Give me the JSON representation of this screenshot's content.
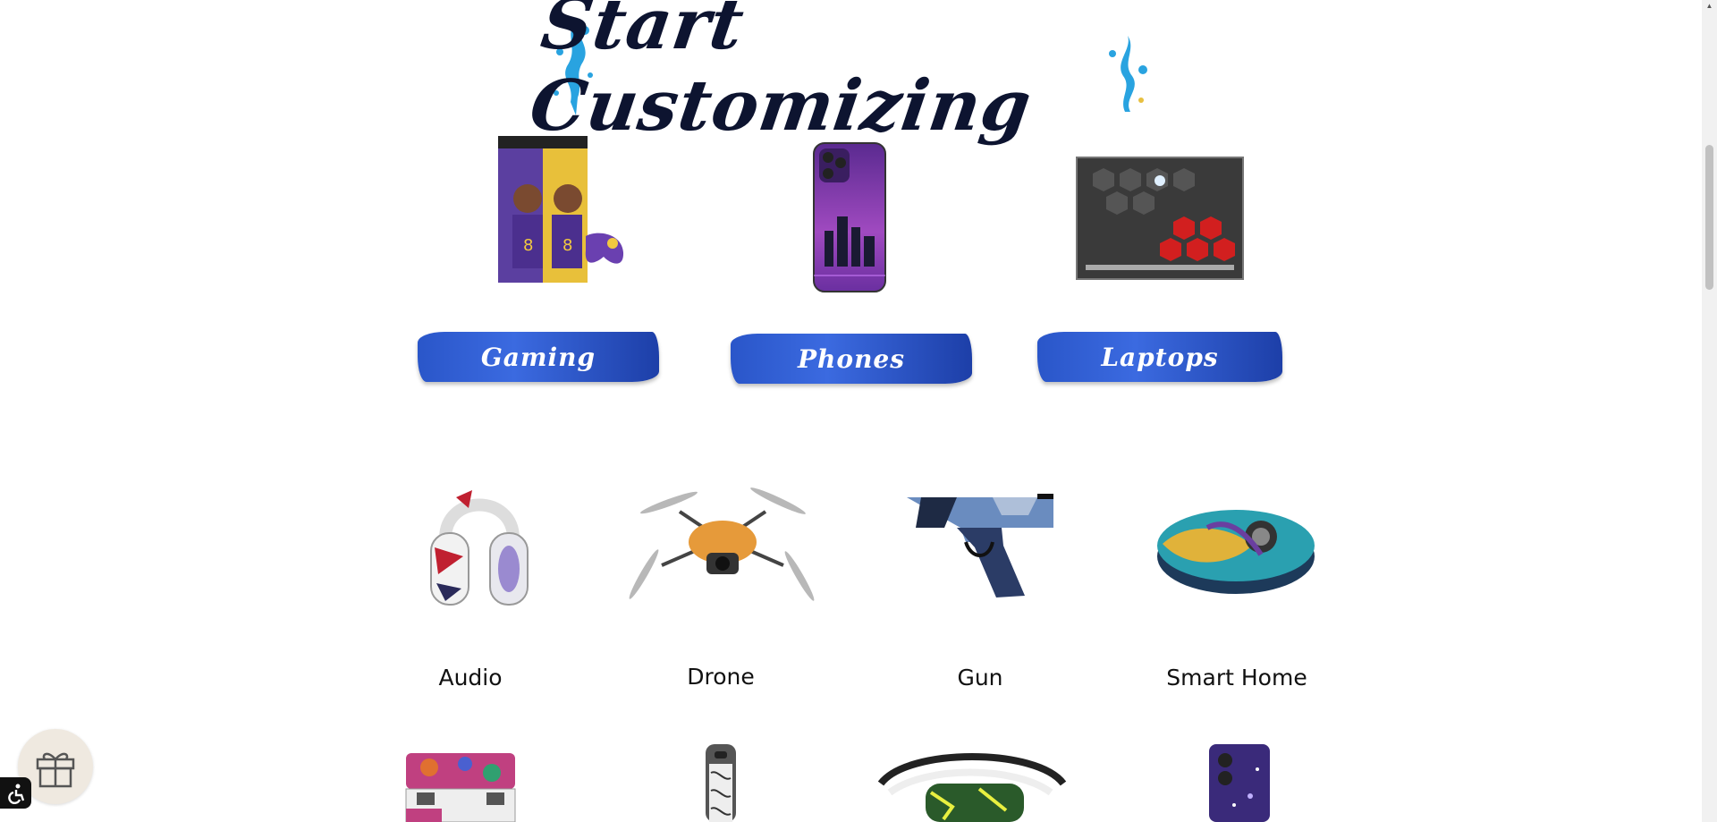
{
  "hero": {
    "title": "Start Customizing"
  },
  "featured": [
    {
      "label": "Gaming",
      "image": "gaming-console-skin-image"
    },
    {
      "label": "Phones",
      "image": "phone-skin-image"
    },
    {
      "label": "Laptops",
      "image": "laptop-skin-image"
    }
  ],
  "categories": [
    {
      "label": "Audio"
    },
    {
      "label": "Drone"
    },
    {
      "label": "Gun"
    },
    {
      "label": "Smart Home"
    }
  ],
  "colors": {
    "brand_blue": "#2a56c9",
    "title_navy": "#0d1430",
    "splash_blue": "#29a3e0"
  },
  "widgets": {
    "gift": "gift-icon",
    "accessibility": "accessibility-icon"
  }
}
